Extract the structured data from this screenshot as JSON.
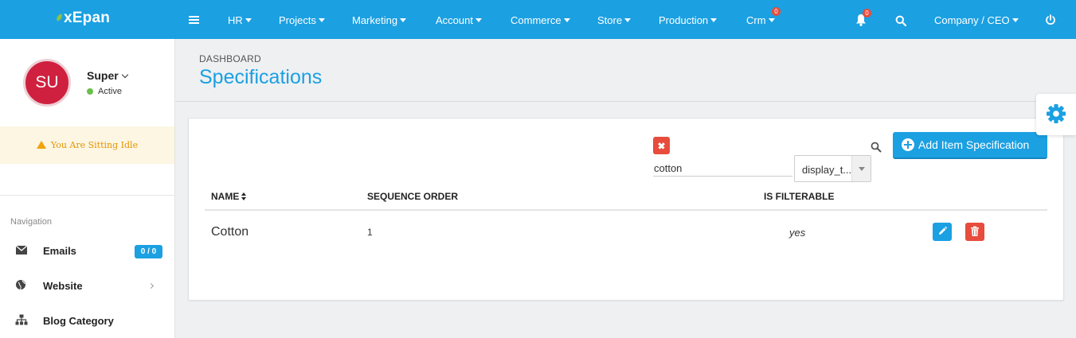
{
  "brand": {
    "name": "xEpan"
  },
  "topnav": {
    "items": [
      {
        "label": "HR"
      },
      {
        "label": "Projects"
      },
      {
        "label": "Marketing"
      },
      {
        "label": "Account"
      },
      {
        "label": "Commerce"
      },
      {
        "label": "Store"
      },
      {
        "label": "Production"
      },
      {
        "label": "Crm",
        "badge": "0"
      }
    ],
    "notifications_badge": "0",
    "company_label": "Company / CEO"
  },
  "sidebar": {
    "avatar_initials": "SU",
    "user_name": "Super",
    "status": "Active",
    "idle_message": "You Are Sitting Idle",
    "nav_title": "Navigation",
    "items": [
      {
        "label": "Emails",
        "badge": "0 / 0",
        "icon": "envelope-icon"
      },
      {
        "label": "Website",
        "icon": "globe-icon"
      },
      {
        "label": "Blog Category",
        "icon": "sitemap-icon"
      }
    ]
  },
  "page": {
    "breadcrumb": "DASHBOARD",
    "title": "Specifications"
  },
  "toolbar": {
    "search_value": "cotton",
    "select_value": "display_t...",
    "add_label": "Add Item Specification"
  },
  "table": {
    "columns": [
      "NAME",
      "SEQUENCE ORDER",
      "IS FILTERABLE"
    ],
    "rows": [
      {
        "name": "Cotton",
        "sequence_order": "1",
        "is_filterable": "yes"
      }
    ]
  },
  "colors": {
    "primary": "#1ba0e2",
    "danger": "#e74c3c",
    "avatar": "#d0203f",
    "idle_text": "#e59400"
  }
}
